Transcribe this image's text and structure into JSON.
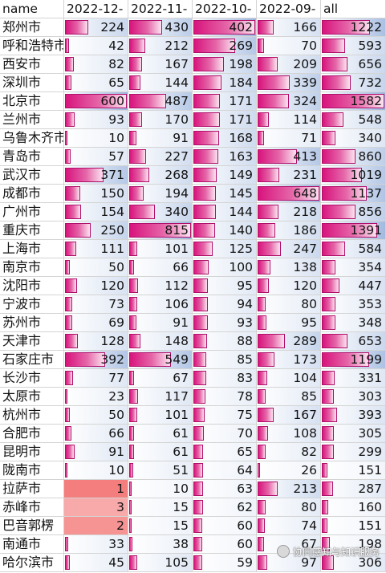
{
  "headers": [
    "name",
    "2022-12-",
    "2022-11-",
    "2022-10-",
    "2022-09-",
    "all"
  ],
  "rows": [
    {
      "name": "郑州市",
      "values": [
        224,
        430,
        402,
        166,
        1222
      ]
    },
    {
      "name": "呼和浩特市",
      "values": [
        42,
        212,
        269,
        70,
        593
      ]
    },
    {
      "name": "西安市",
      "values": [
        82,
        167,
        198,
        209,
        656
      ]
    },
    {
      "name": "深圳市",
      "values": [
        65,
        144,
        184,
        339,
        732
      ]
    },
    {
      "name": "北京市",
      "values": [
        600,
        487,
        171,
        324,
        1582
      ]
    },
    {
      "name": "兰州市",
      "values": [
        93,
        170,
        171,
        114,
        548
      ]
    },
    {
      "name": "乌鲁木齐市",
      "values": [
        10,
        91,
        168,
        71,
        340
      ]
    },
    {
      "name": "青岛市",
      "values": [
        57,
        227,
        163,
        413,
        860
      ]
    },
    {
      "name": "武汉市",
      "values": [
        371,
        268,
        149,
        231,
        1019
      ]
    },
    {
      "name": "成都市",
      "values": [
        150,
        194,
        145,
        648,
        1137
      ]
    },
    {
      "name": "广州市",
      "values": [
        154,
        340,
        144,
        218,
        856
      ]
    },
    {
      "name": "重庆市",
      "values": [
        250,
        815,
        140,
        186,
        1391
      ]
    },
    {
      "name": "上海市",
      "values": [
        111,
        101,
        125,
        247,
        584
      ]
    },
    {
      "name": "南京市",
      "values": [
        50,
        66,
        100,
        138,
        354
      ]
    },
    {
      "name": "沈阳市",
      "values": [
        120,
        112,
        95,
        120,
        447
      ]
    },
    {
      "name": "宁波市",
      "values": [
        73,
        106,
        94,
        80,
        353
      ]
    },
    {
      "name": "苏州市",
      "values": [
        69,
        91,
        93,
        95,
        348
      ]
    },
    {
      "name": "天津市",
      "values": [
        128,
        148,
        88,
        289,
        653
      ]
    },
    {
      "name": "石家庄市",
      "values": [
        392,
        549,
        85,
        173,
        1199
      ]
    },
    {
      "name": "长沙市",
      "values": [
        77,
        67,
        83,
        104,
        331
      ]
    },
    {
      "name": "太原市",
      "values": [
        23,
        117,
        78,
        85,
        303
      ]
    },
    {
      "name": "杭州市",
      "values": [
        50,
        101,
        75,
        167,
        393
      ]
    },
    {
      "name": "合肥市",
      "values": [
        66,
        61,
        70,
        108,
        305
      ]
    },
    {
      "name": "昆明市",
      "values": [
        91,
        61,
        65,
        82,
        299
      ]
    },
    {
      "name": "陇南市",
      "values": [
        10,
        51,
        64,
        26,
        151
      ]
    },
    {
      "name": "拉萨市",
      "values": [
        1,
        10,
        63,
        213,
        287
      ]
    },
    {
      "name": "赤峰市",
      "values": [
        3,
        15,
        62,
        80,
        160
      ]
    },
    {
      "name": "巴音郭楞",
      "values": [
        2,
        15,
        60,
        74,
        151
      ]
    },
    {
      "name": "南通市",
      "values": [
        33,
        38,
        60,
        67,
        198
      ]
    },
    {
      "name": "哈尔滨市",
      "values": [
        45,
        105,
        59,
        97,
        306
      ]
    }
  ],
  "watermark": "协同感知与知识服务",
  "watermark_icon": "wechat-account-icon",
  "colors": {
    "bar": "#d8147d",
    "tint_blue": "#4f7cc4",
    "low_red": "#f36f6f",
    "grid": "#d4d4d4"
  }
}
